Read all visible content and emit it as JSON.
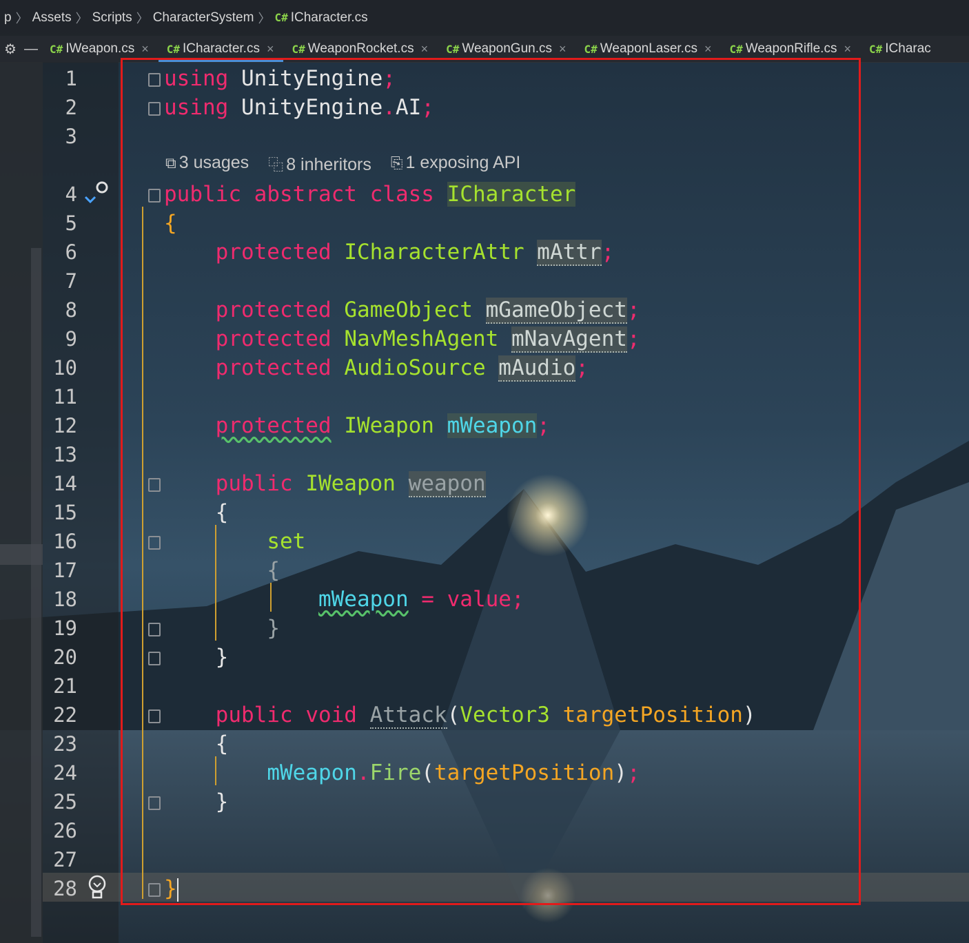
{
  "breadcrumb": {
    "items": [
      "p",
      "Assets",
      "Scripts",
      "CharacterSystem",
      "ICharacter.cs"
    ],
    "file_lang": "C#"
  },
  "tabs": [
    {
      "lang": "C#",
      "label": "IWeapon.cs",
      "close": "×"
    },
    {
      "lang": "C#",
      "label": "ICharacter.cs",
      "close": "×",
      "active": true
    },
    {
      "lang": "C#",
      "label": "WeaponRocket.cs",
      "close": "×"
    },
    {
      "lang": "C#",
      "label": "WeaponGun.cs",
      "close": "×"
    },
    {
      "lang": "C#",
      "label": "WeaponLaser.cs",
      "close": "×"
    },
    {
      "lang": "C#",
      "label": "WeaponRifle.cs",
      "close": "×"
    },
    {
      "lang": "C#",
      "label": "ICharac",
      "close": ""
    }
  ],
  "code_hint": {
    "usages": "3 usages",
    "inheritors": "8 inheritors",
    "exposing": "1 exposing API"
  },
  "line_numbers": [
    "1",
    "2",
    "3",
    "4",
    "5",
    "6",
    "7",
    "8",
    "9",
    "10",
    "11",
    "12",
    "13",
    "14",
    "15",
    "16",
    "17",
    "18",
    "19",
    "20",
    "21",
    "22",
    "23",
    "24",
    "25",
    "26",
    "27",
    "28"
  ],
  "code": {
    "l1": {
      "kw": "using",
      "ns": "UnityEngine",
      "end": ";"
    },
    "l2": {
      "kw": "using",
      "ns": "UnityEngine",
      "dot": ".",
      "ns2": "AI",
      "end": ";"
    },
    "l4": {
      "kw1": "public",
      "kw2": "abstract",
      "kw3": "class",
      "name": "ICharacter"
    },
    "l5": {
      "brace": "{"
    },
    "l6": {
      "kw": "protected",
      "type": "ICharacterAttr",
      "field": "mAttr",
      "end": ";"
    },
    "l8": {
      "kw": "protected",
      "type": "GameObject",
      "field": "mGameObject",
      "end": ";"
    },
    "l9": {
      "kw": "protected",
      "type": "NavMeshAgent",
      "field": "mNavAgent",
      "end": ";"
    },
    "l10": {
      "kw": "protected",
      "type": "AudioSource",
      "field": "mAudio",
      "end": ";"
    },
    "l12": {
      "kw": "protected",
      "type": "IWeapon",
      "field": "mWeapon",
      "end": ";"
    },
    "l14": {
      "kw": "public",
      "type": "IWeapon",
      "field": "weapon"
    },
    "l15": {
      "brace": "{"
    },
    "l16": {
      "kw": "set"
    },
    "l17": {
      "brace": "{"
    },
    "l18": {
      "field": "mWeapon",
      "op": "=",
      "val": "value",
      "end": ";"
    },
    "l19": {
      "brace": "}"
    },
    "l20": {
      "brace": "}"
    },
    "l22": {
      "kw1": "public",
      "kw2": "void",
      "fn": "Attack",
      "open": "(",
      "ptype": "Vector3",
      "pname": "targetPosition",
      "close": ")"
    },
    "l23": {
      "brace": "{"
    },
    "l24": {
      "field": "mWeapon",
      "dot": ".",
      "fn": "Fire",
      "open": "(",
      "arg": "targetPosition",
      "close": ")",
      "end": ";"
    },
    "l25": {
      "brace": "}"
    },
    "l28": {
      "brace": "}"
    }
  }
}
